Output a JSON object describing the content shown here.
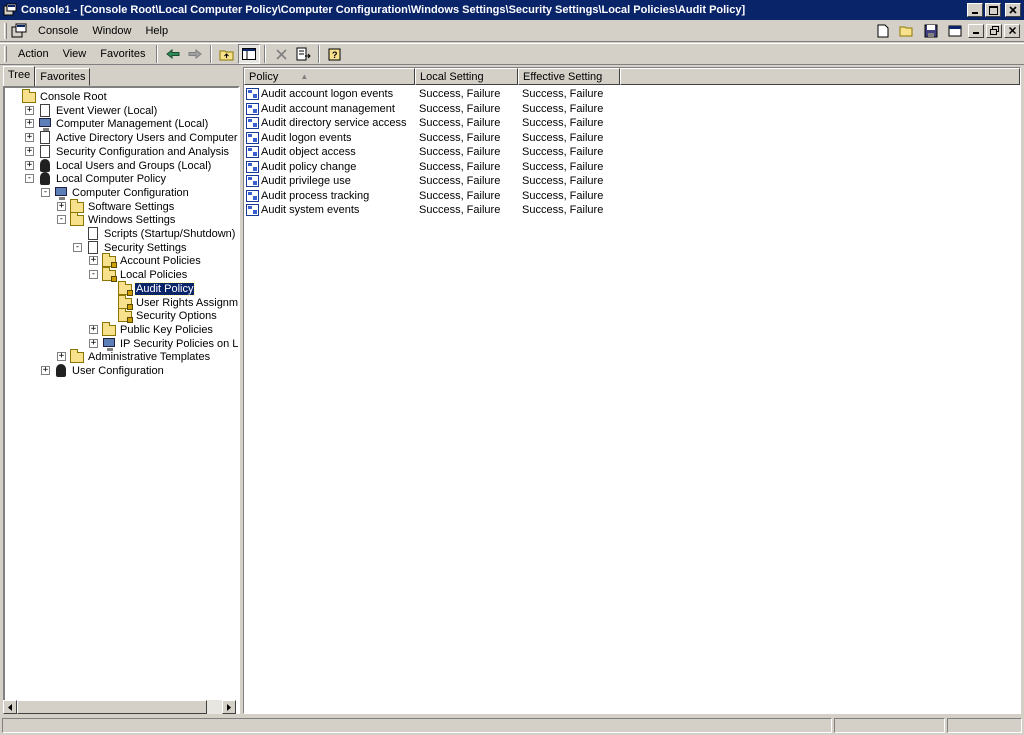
{
  "window": {
    "title": "Console1 - [Console Root\\Local Computer Policy\\Computer Configuration\\Windows Settings\\Security Settings\\Local Policies\\Audit Policy]"
  },
  "menubar": {
    "items": [
      {
        "label": "Console"
      },
      {
        "label": "Window"
      },
      {
        "label": "Help"
      }
    ]
  },
  "toolbar": {
    "items": [
      {
        "label": "Action"
      },
      {
        "label": "View"
      },
      {
        "label": "Favorites"
      }
    ]
  },
  "tabs": [
    {
      "label": "Tree",
      "active": true
    },
    {
      "label": "Favorites",
      "active": false
    }
  ],
  "tree": [
    {
      "label": "Console Root",
      "icon": "folder-icon",
      "level": 0,
      "expander": ""
    },
    {
      "label": "Event Viewer (Local)",
      "icon": "event-viewer-icon",
      "level": 1,
      "expander": "+"
    },
    {
      "label": "Computer Management (Local)",
      "icon": "computer-icon",
      "level": 1,
      "expander": "+"
    },
    {
      "label": "Active Directory Users and Computers",
      "icon": "directory-icon",
      "level": 1,
      "expander": "+"
    },
    {
      "label": "Security Configuration and Analysis",
      "icon": "security-icon",
      "level": 1,
      "expander": "+"
    },
    {
      "label": "Local Users and Groups (Local)",
      "icon": "users-icon",
      "level": 1,
      "expander": "+"
    },
    {
      "label": "Local Computer Policy",
      "icon": "policy-icon",
      "level": 1,
      "expander": "-"
    },
    {
      "label": "Computer Configuration",
      "icon": "computer-icon",
      "level": 2,
      "expander": "-"
    },
    {
      "label": "Software Settings",
      "icon": "folder-icon",
      "level": 3,
      "expander": "+"
    },
    {
      "label": "Windows Settings",
      "icon": "folder-icon",
      "level": 3,
      "expander": "-"
    },
    {
      "label": "Scripts (Startup/Shutdown)",
      "icon": "script-icon",
      "level": 4,
      "expander": ""
    },
    {
      "label": "Security Settings",
      "icon": "security-settings-icon",
      "level": 4,
      "expander": "-"
    },
    {
      "label": "Account Policies",
      "icon": "locked-folder-icon",
      "level": 5,
      "expander": "+"
    },
    {
      "label": "Local Policies",
      "icon": "locked-folder-icon",
      "level": 5,
      "expander": "-"
    },
    {
      "label": "Audit Policy",
      "icon": "locked-folder-icon",
      "level": 6,
      "expander": "",
      "selected": true
    },
    {
      "label": "User Rights Assignment",
      "icon": "locked-folder-icon",
      "level": 6,
      "expander": ""
    },
    {
      "label": "Security Options",
      "icon": "locked-folder-icon",
      "level": 6,
      "expander": ""
    },
    {
      "label": "Public Key Policies",
      "icon": "folder-icon",
      "level": 5,
      "expander": "+"
    },
    {
      "label": "IP Security Policies on Local Mach",
      "icon": "ip-security-icon",
      "level": 5,
      "expander": "+"
    },
    {
      "label": "Administrative Templates",
      "icon": "folder-icon",
      "level": 3,
      "expander": "+"
    },
    {
      "label": "User Configuration",
      "icon": "users-icon",
      "level": 2,
      "expander": "+"
    }
  ],
  "list": {
    "columns": [
      {
        "label": "Policy",
        "sorted": true
      },
      {
        "label": "Local Setting"
      },
      {
        "label": "Effective Setting"
      }
    ],
    "rows": [
      {
        "policy": "Audit account logon events",
        "local": "Success, Failure",
        "effective": "Success, Failure"
      },
      {
        "policy": "Audit account management",
        "local": "Success, Failure",
        "effective": "Success, Failure"
      },
      {
        "policy": "Audit directory service access",
        "local": "Success, Failure",
        "effective": "Success, Failure"
      },
      {
        "policy": "Audit logon events",
        "local": "Success, Failure",
        "effective": "Success, Failure"
      },
      {
        "policy": "Audit object access",
        "local": "Success, Failure",
        "effective": "Success, Failure"
      },
      {
        "policy": "Audit policy change",
        "local": "Success, Failure",
        "effective": "Success, Failure"
      },
      {
        "policy": "Audit privilege use",
        "local": "Success, Failure",
        "effective": "Success, Failure"
      },
      {
        "policy": "Audit process tracking",
        "local": "Success, Failure",
        "effective": "Success, Failure"
      },
      {
        "policy": "Audit system events",
        "local": "Success, Failure",
        "effective": "Success, Failure"
      }
    ]
  },
  "colors": {
    "titlebar": "#0a246a",
    "selection": "#0a246a",
    "chrome": "#d4d0c8"
  }
}
